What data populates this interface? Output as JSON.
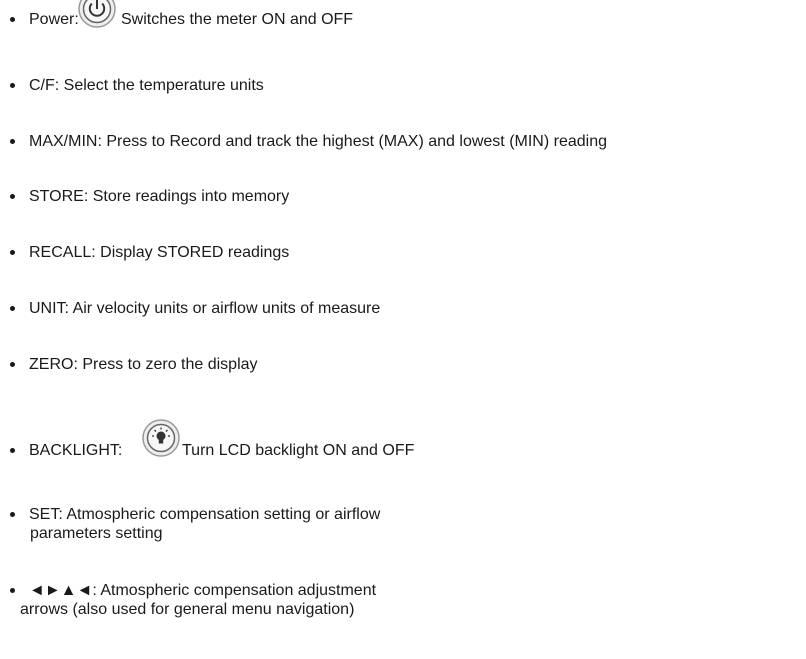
{
  "items": [
    {
      "label": "Power:",
      "text": "Switches the meter ON and  OFF",
      "icon": "power-icon"
    },
    {
      "text": "C/F: Select the temperature units"
    },
    {
      "text": "MAX/MIN: Press to Record and track the highest (MAX) and lowest (MIN) reading"
    },
    {
      "text": "STORE: Store readings into memory"
    },
    {
      "text": "RECALL: Display STORED readings"
    },
    {
      "text": "UNIT: Air velocity units or airflow units of measure"
    },
    {
      "text": "ZERO: Press to zero the display"
    },
    {
      "label": "BACKLIGHT:",
      "text": "Turn LCD backlight ON and OFF",
      "icon": "lightbulb-icon"
    },
    {
      "line1": "SET: Atmospheric compensation setting or airflow",
      "line2": "parameters setting"
    },
    {
      "line1": "◄►▲◄: Atmospheric compensation adjustment",
      "line2": "arrows (also used for general menu navigation)"
    }
  ]
}
